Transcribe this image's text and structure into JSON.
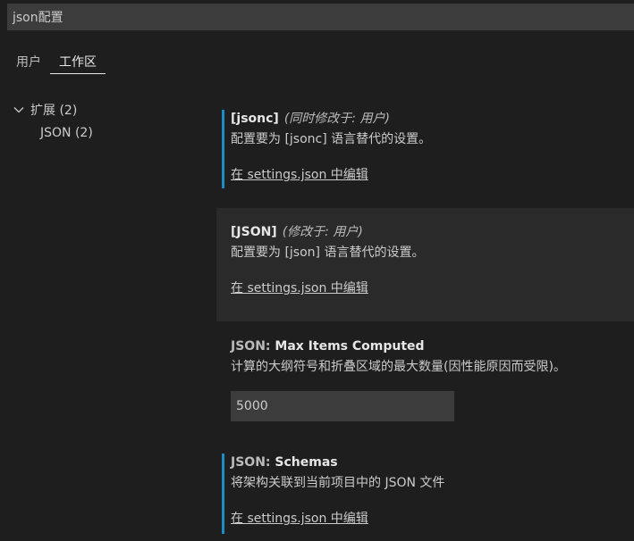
{
  "search": {
    "value": "json配置"
  },
  "tabs": [
    {
      "label": "用户"
    },
    {
      "label": "工作区",
      "active": true
    }
  ],
  "toc": {
    "group_label": "扩展 (2)",
    "child_label": "JSON (2)"
  },
  "settings": [
    {
      "name": "[jsonc]",
      "modified": "(同时修改于: 用户)",
      "description": "配置要为 [jsonc] 语言替代的设置。",
      "link": "在 settings.json 中编辑"
    },
    {
      "name": "[JSON]",
      "modified": "(修改于: 用户)",
      "description": "配置要为 [json] 语言替代的设置。",
      "link": "在 settings.json 中编辑"
    },
    {
      "category": "JSON: ",
      "name": "Max Items Computed",
      "description": "计算的大纲符号和折叠区域的最大数量(因性能原因而受限)。",
      "value": "5000"
    },
    {
      "category": "JSON: ",
      "name": "Schemas",
      "description": "将架构关联到当前项目中的 JSON 文件",
      "link": "在 settings.json 中编辑"
    }
  ],
  "colors": {
    "background": "#1e1e1e",
    "input_background": "#3c3c3c",
    "modified_indicator": "#1b8dc7"
  }
}
